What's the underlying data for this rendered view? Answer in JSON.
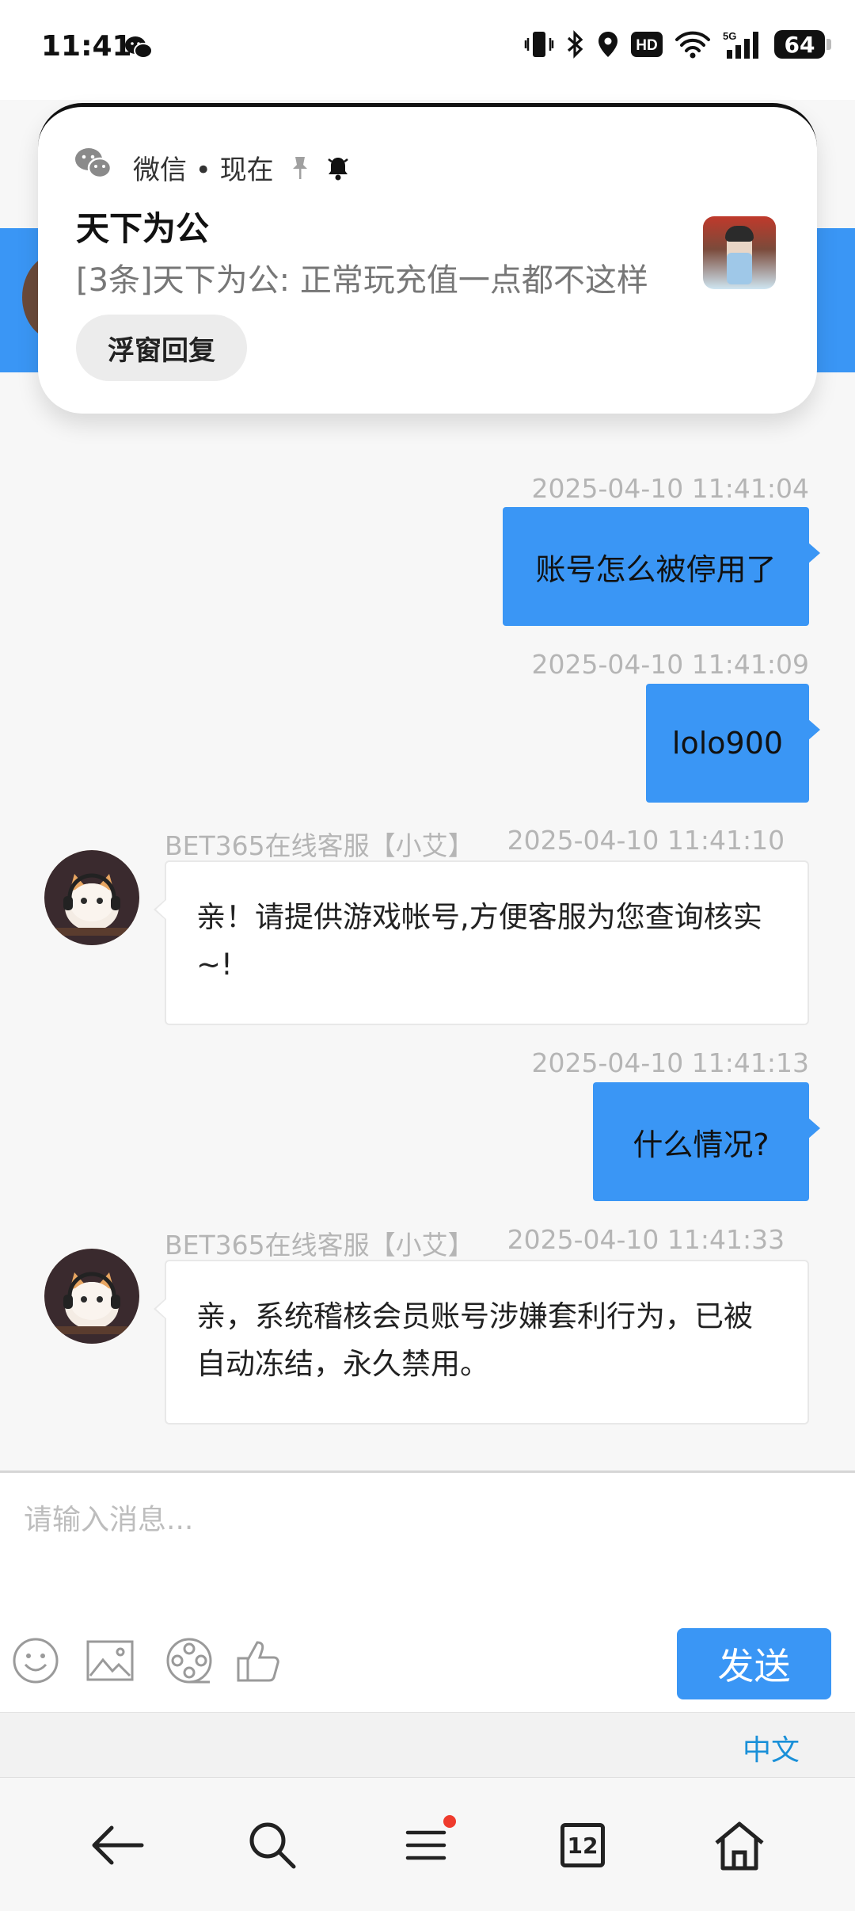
{
  "status_bar": {
    "time": "11:41",
    "battery": "64",
    "icons": [
      "wechat-icon",
      "vibrate-icon",
      "bluetooth-icon",
      "location-icon",
      "hd-icon",
      "wifi-icon",
      "5g-signal-icon",
      "battery-icon"
    ]
  },
  "notification": {
    "app_line": "微信 • 现在",
    "title": "天下为公",
    "body": "[3条]天下为公: 正常玩充值一点都不这样",
    "reply_label": "浮窗回复"
  },
  "chat": {
    "messages": [
      {
        "from": "me",
        "timestamp": "2025-04-10 11:41:04",
        "text": "账号怎么被停用了"
      },
      {
        "from": "me",
        "timestamp": "2025-04-10 11:41:09",
        "text": "lolo900"
      },
      {
        "from": "agent",
        "sender": "BET365在线客服【小艾】",
        "timestamp": "2025-04-10 11:41:10",
        "text": "亲！请提供游戏帐号,方便客服为您查询核实~!"
      },
      {
        "from": "me",
        "timestamp": "2025-04-10 11:41:13",
        "text": "什么情况?"
      },
      {
        "from": "agent",
        "sender": "BET365在线客服【小艾】",
        "timestamp": "2025-04-10 11:41:33",
        "text": "亲，系统稽核会员账号涉嫌套利行为，已被自动冻结，永久禁用。"
      }
    ]
  },
  "composer": {
    "placeholder": "请输入消息...",
    "send_label": "发送",
    "tools": [
      "emoji-icon",
      "image-icon",
      "video-icon",
      "thumbs-up-icon"
    ]
  },
  "ime": {
    "language": "中文"
  },
  "browser_nav": {
    "items": [
      "back-arrow-icon",
      "search-icon",
      "menu-icon",
      "tabs-icon",
      "home-icon"
    ],
    "tab_count": "12",
    "menu_has_badge": true
  },
  "colors": {
    "accent": "#3a96f5",
    "ime_language": "#1a90d8",
    "badge": "#ef3b2d"
  }
}
